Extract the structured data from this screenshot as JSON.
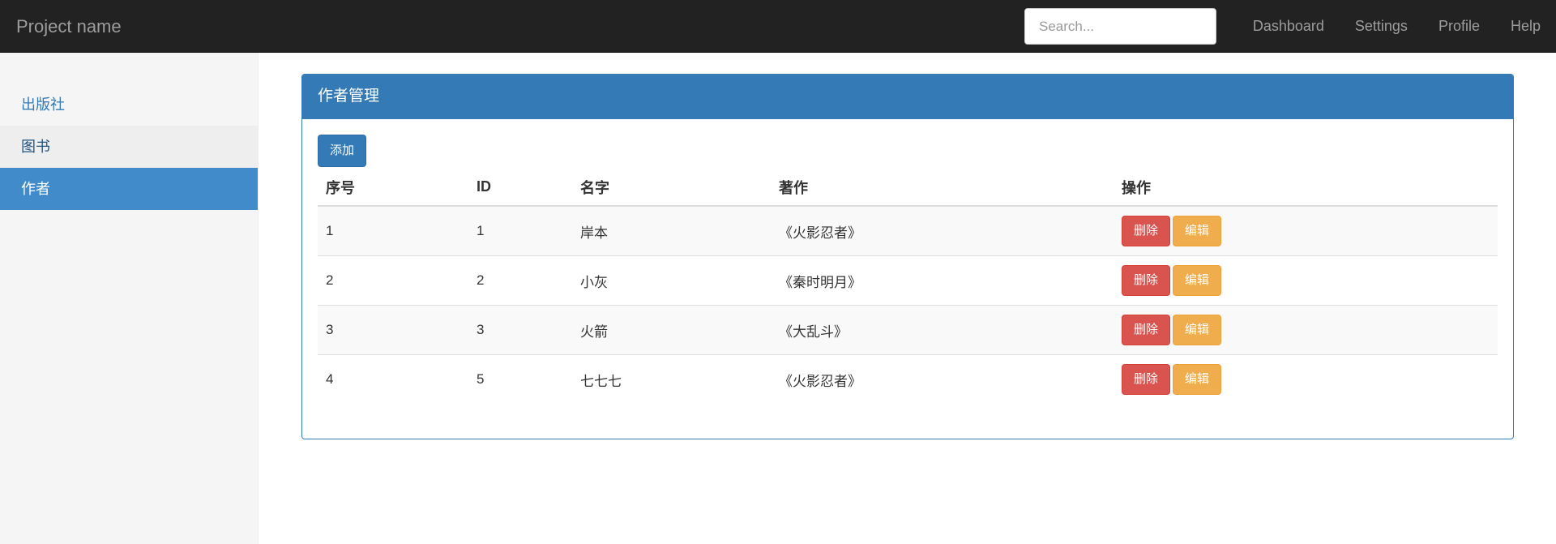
{
  "navbar": {
    "brand": "Project name",
    "search_placeholder": "Search...",
    "links": [
      "Dashboard",
      "Settings",
      "Profile",
      "Help"
    ]
  },
  "sidebar": {
    "items": [
      {
        "label": "出版社",
        "state": "normal"
      },
      {
        "label": "图书",
        "state": "hover"
      },
      {
        "label": "作者",
        "state": "active"
      }
    ]
  },
  "panel": {
    "title": "作者管理",
    "add_label": "添加",
    "columns": [
      "序号",
      "ID",
      "名字",
      "著作",
      "操作"
    ],
    "rows": [
      {
        "index": "1",
        "id": "1",
        "name": "岸本",
        "works": "《火影忍者》"
      },
      {
        "index": "2",
        "id": "2",
        "name": "小灰",
        "works": "《秦时明月》"
      },
      {
        "index": "3",
        "id": "3",
        "name": "火箭",
        "works": "《大乱斗》"
      },
      {
        "index": "4",
        "id": "5",
        "name": "七七七",
        "works": "《火影忍者》"
      }
    ],
    "delete_label": "删除",
    "edit_label": "编辑"
  },
  "colors": {
    "navbar_bg": "#222222",
    "primary": "#337ab7",
    "sidebar_active": "#428bca",
    "danger": "#d9534f",
    "warning": "#f0ad4e"
  }
}
